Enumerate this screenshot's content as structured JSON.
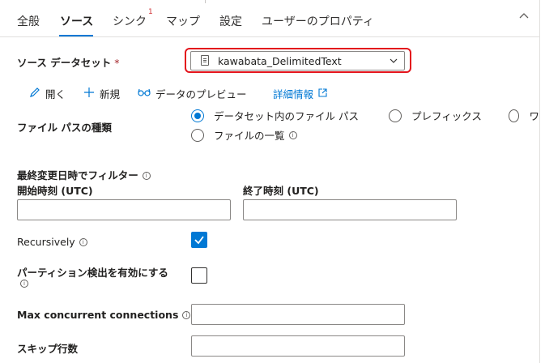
{
  "tabs": [
    {
      "label": "全般"
    },
    {
      "label": "ソース"
    },
    {
      "label": "シンク",
      "badge": "1"
    },
    {
      "label": "マップ"
    },
    {
      "label": "設定"
    },
    {
      "label": "ユーザーのプロパティ"
    }
  ],
  "source_dataset": {
    "label": "ソース データセット",
    "required_mark": "*",
    "value": "kawabata_DelimitedText"
  },
  "actions": {
    "open": "開く",
    "new": "新規",
    "preview": "データのプレビュー",
    "details": "詳細情報"
  },
  "file_path_type": {
    "label": "ファイル パスの種類",
    "options": [
      "データセット内のファイル パス",
      "プレフィックス",
      "ワ",
      "ファイルの一覧"
    ],
    "selected": "データセット内のファイル パス"
  },
  "filter": {
    "label": "最終変更日時でフィルター",
    "start_label": "開始時刻 (UTC)",
    "end_label": "終了時刻 (UTC)",
    "start_value": "",
    "end_value": ""
  },
  "recursively": {
    "label": "Recursively",
    "checked": true
  },
  "partition": {
    "label": "パーティション検出を有効にする",
    "checked": false
  },
  "max_concurrent": {
    "label": "Max concurrent connections",
    "value": ""
  },
  "skip_lines": {
    "label": "スキップ行数",
    "value": ""
  },
  "colors": {
    "accent": "#0078d4",
    "highlight": "#e3141c",
    "badge": "#d13438"
  }
}
